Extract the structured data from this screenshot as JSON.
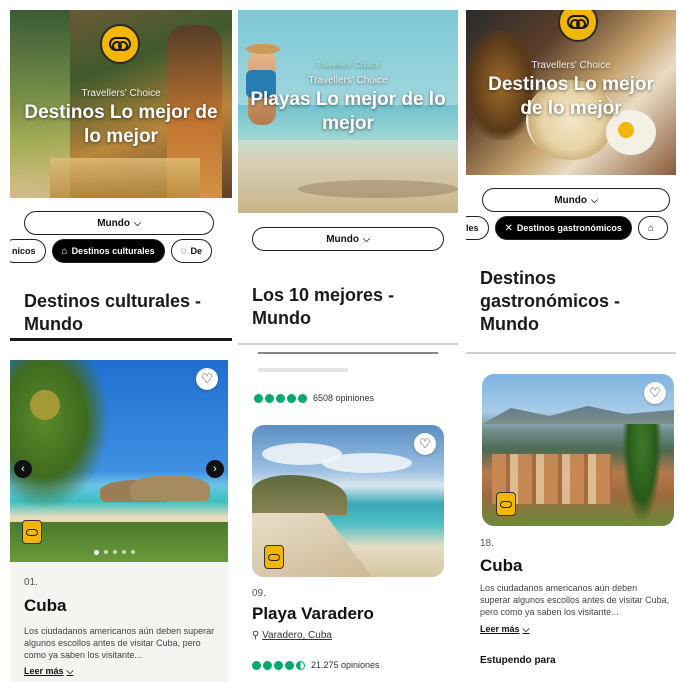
{
  "panels": [
    {
      "hero": {
        "label": "Travellers' Choice",
        "title": "Destinos Lo mejor de lo mejor"
      },
      "filter": {
        "label": "Mundo"
      },
      "chips": [
        {
          "label": "nicos",
          "icon": ""
        },
        {
          "label": "Destinos culturales",
          "icon": "landmark-icon",
          "active": true
        },
        {
          "label": "De",
          "icon": "chat-icon"
        }
      ],
      "section_title": "Destinos culturales - Mundo",
      "card": {
        "rank": "01.",
        "name": "Cuba",
        "description": "Los ciudadanos americanos aún deben superar algunos escollos antes de visitar Cuba, pero como ya saben los visitante...",
        "read_more": "Leer más"
      }
    },
    {
      "hero": {
        "label_small": "Travellers' Choice",
        "label": "Travellers' Choice",
        "title": "Playas Lo mejor de lo mejor"
      },
      "filter": {
        "label": "Mundo"
      },
      "section_title": "Los 10 mejores - Mundo",
      "prev_rating": {
        "bubbles": 5,
        "count": "6508 opiniones"
      },
      "card": {
        "rank": "09.",
        "name": "Playa Varadero",
        "location": "Varadero, Cuba",
        "rating": {
          "bubbles": 4.5,
          "count": "21.275 opiniones"
        }
      }
    },
    {
      "hero": {
        "label": "Travellers' Choice",
        "title": "Destinos Lo mejor de lo mejor"
      },
      "filter": {
        "label": "Mundo"
      },
      "chips": [
        {
          "label": "les",
          "icon": ""
        },
        {
          "label": "Destinos gastronómicos",
          "icon": "utensils-icon",
          "active": true
        },
        {
          "label": "",
          "icon": "landmark-icon"
        }
      ],
      "section_title": "Destinos gastronómicos - Mundo",
      "card": {
        "rank": "18.",
        "name": "Cuba",
        "description": "Los ciudadanos americanos aún deben superar algunos escollos antes de visitar Cuba, pero como ya saben los visitante...",
        "read_more": "Leer más",
        "footer": "Estupendo para"
      }
    }
  ],
  "colors": {
    "rating_green": "#00aa6c",
    "badge_yellow": "#f2b705",
    "active_chip": "#000000"
  }
}
